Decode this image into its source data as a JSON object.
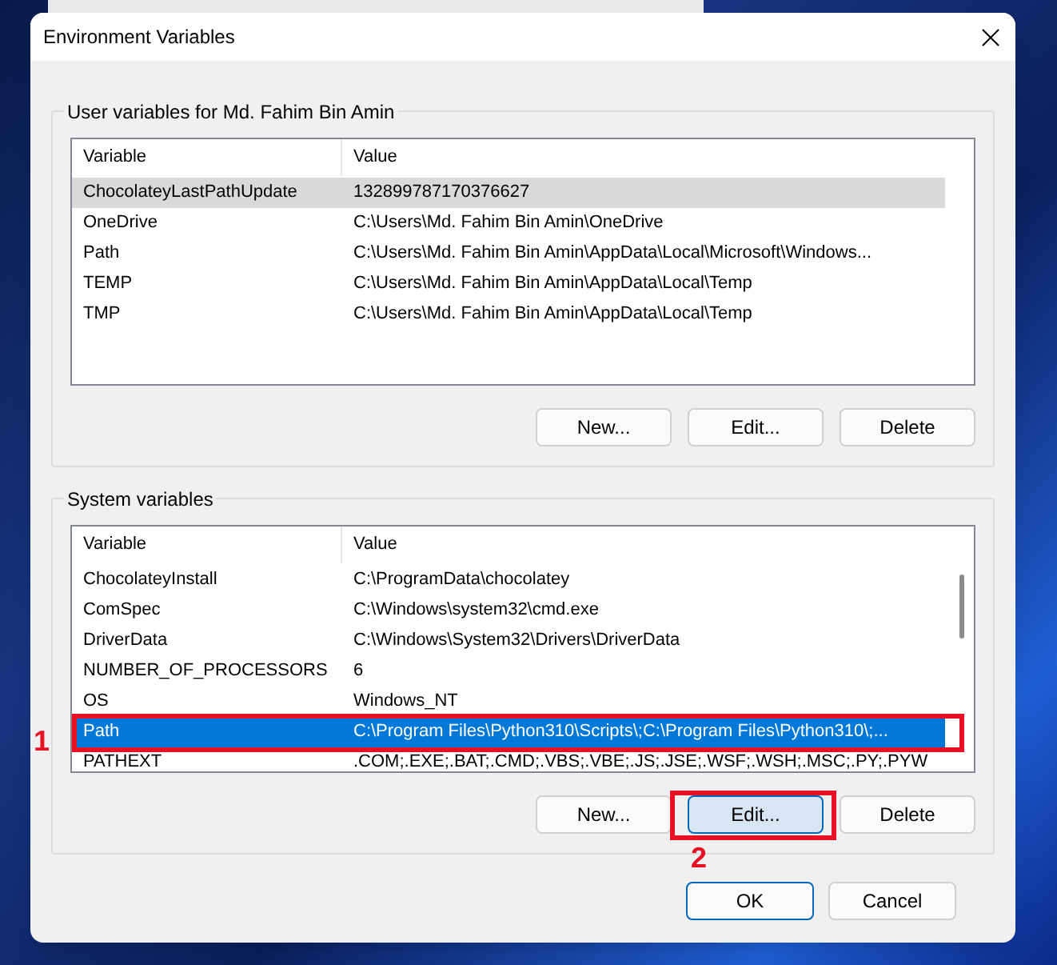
{
  "window": {
    "title": "Environment Variables"
  },
  "user_variables": {
    "label": "User variables for Md. Fahim Bin Amin",
    "focused": false,
    "columns": [
      "Variable",
      "Value"
    ],
    "rows": [
      {
        "variable": "ChocolateyLastPathUpdate",
        "value": "132899787170376627",
        "selected": true
      },
      {
        "variable": "OneDrive",
        "value": "C:\\Users\\Md. Fahim Bin Amin\\OneDrive",
        "selected": false
      },
      {
        "variable": "Path",
        "value": "C:\\Users\\Md. Fahim Bin Amin\\AppData\\Local\\Microsoft\\Windows...",
        "selected": false
      },
      {
        "variable": "TEMP",
        "value": "C:\\Users\\Md. Fahim Bin Amin\\AppData\\Local\\Temp",
        "selected": false
      },
      {
        "variable": "TMP",
        "value": "C:\\Users\\Md. Fahim Bin Amin\\AppData\\Local\\Temp",
        "selected": false
      }
    ],
    "buttons": [
      {
        "label": "New...",
        "highlighted": false
      },
      {
        "label": "Edit...",
        "highlighted": false
      },
      {
        "label": "Delete",
        "highlighted": false
      }
    ]
  },
  "system_variables": {
    "label": "System variables",
    "focused": true,
    "columns": [
      "Variable",
      "Value"
    ],
    "rows": [
      {
        "variable": "ChocolateyInstall",
        "value": "C:\\ProgramData\\chocolatey",
        "selected": false
      },
      {
        "variable": "ComSpec",
        "value": "C:\\Windows\\system32\\cmd.exe",
        "selected": false
      },
      {
        "variable": "DriverData",
        "value": "C:\\Windows\\System32\\Drivers\\DriverData",
        "selected": false
      },
      {
        "variable": "NUMBER_OF_PROCESSORS",
        "value": "6",
        "selected": false
      },
      {
        "variable": "OS",
        "value": "Windows_NT",
        "selected": false
      },
      {
        "variable": "Path",
        "value": "C:\\Program Files\\Python310\\Scripts\\;C:\\Program Files\\Python310\\;...",
        "selected": true
      },
      {
        "variable": "PATHEXT",
        "value": ".COM;.EXE;.BAT;.CMD;.VBS;.VBE;.JS;.JSE;.WSF;.WSH;.MSC;.PY;.PYW",
        "selected": false
      }
    ],
    "buttons": [
      {
        "label": "New...",
        "highlighted": false
      },
      {
        "label": "Edit...",
        "highlighted": true
      },
      {
        "label": "Delete",
        "highlighted": false
      }
    ]
  },
  "buttons": [
    {
      "label": "OK",
      "default": true
    },
    {
      "label": "Cancel",
      "default": false
    }
  ],
  "annotations": [
    {
      "label": "1"
    },
    {
      "label": "2"
    }
  ]
}
